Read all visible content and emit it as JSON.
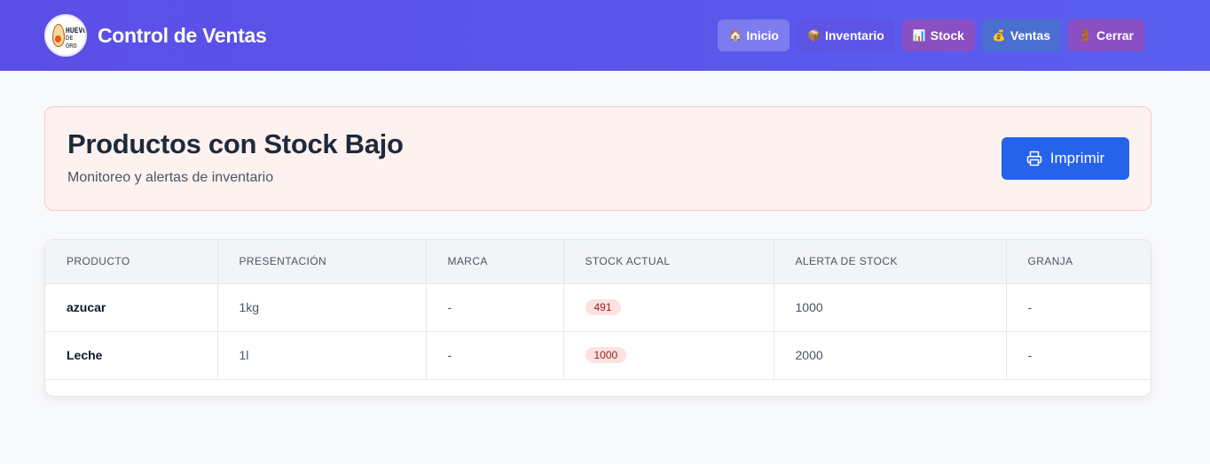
{
  "app": {
    "logo_text_top": "HUEVO",
    "logo_text_bottom": "DE ORO",
    "title": "Control de Ventas"
  },
  "nav": [
    {
      "label": "Inicio",
      "icon": "house-icon",
      "glyph": "🏠"
    },
    {
      "label": "Inventario",
      "icon": "package-icon",
      "glyph": "📦"
    },
    {
      "label": "Stock",
      "icon": "bar-chart-icon",
      "glyph": "📊"
    },
    {
      "label": "Ventas",
      "icon": "money-bag-icon",
      "glyph": "💰"
    },
    {
      "label": "Cerrar",
      "icon": "door-icon",
      "glyph": "🚪"
    }
  ],
  "alert": {
    "title": "Productos con Stock Bajo",
    "subtitle": "Monitoreo y alertas de inventario",
    "print_label": "Imprimir"
  },
  "table": {
    "headers": [
      "PRODUCTO",
      "PRESENTACIÓN",
      "MARCA",
      "STOCK ACTUAL",
      "ALERTA DE STOCK",
      "GRANJA"
    ],
    "rows": [
      {
        "producto": "azucar",
        "presentacion": "1kg",
        "marca": "-",
        "stock_actual": "491",
        "alerta": "1000",
        "granja": "-"
      },
      {
        "producto": "Leche",
        "presentacion": "1l",
        "marca": "-",
        "stock_actual": "1000",
        "alerta": "2000",
        "granja": "-"
      }
    ]
  },
  "colors": {
    "header_gradient_start": "#5b4ee6",
    "header_gradient_end": "#5b5fef",
    "primary_button": "#2563eb",
    "alert_background": "#fef2f0",
    "alert_border": "#f7c9c3",
    "stock_badge_bg": "#fde2e2",
    "stock_badge_text": "#991b1b"
  }
}
